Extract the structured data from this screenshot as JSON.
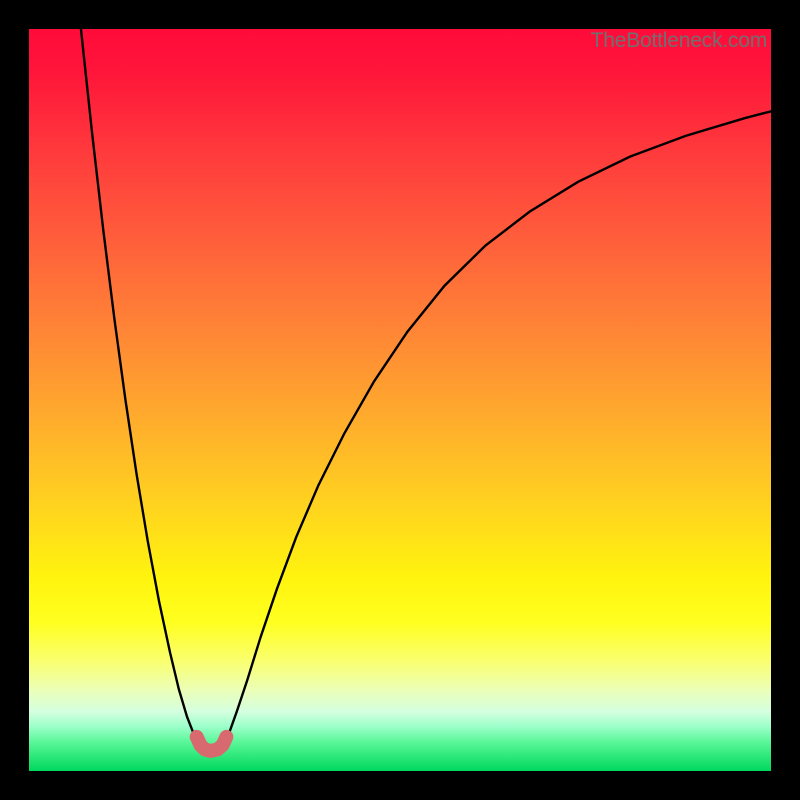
{
  "watermark": "TheBottleneck.com",
  "chart_data": {
    "type": "line",
    "title": "",
    "xlabel": "",
    "ylabel": "",
    "xlim": [
      0,
      100
    ],
    "ylim": [
      0,
      100
    ],
    "legend": false,
    "grid": false,
    "background_gradient": {
      "top": "#ff0b3a",
      "bottom": "#00d85f",
      "stops": [
        "red",
        "orange",
        "yellow",
        "green"
      ]
    },
    "series": [
      {
        "name": "left-branch",
        "stroke": "#000000",
        "x": [
          7.0,
          8.5,
          10.0,
          11.5,
          13.0,
          14.5,
          16.0,
          17.5,
          19.0,
          20.2,
          21.3,
          22.2,
          23.0
        ],
        "y": [
          100.0,
          86.0,
          73.0,
          61.0,
          50.0,
          40.0,
          31.0,
          23.0,
          16.0,
          11.0,
          7.3,
          5.0,
          3.6
        ]
      },
      {
        "name": "right-branch",
        "stroke": "#000000",
        "x": [
          26.2,
          27.0,
          28.0,
          29.4,
          31.2,
          33.4,
          36.0,
          39.0,
          42.5,
          46.5,
          51.0,
          56.0,
          61.5,
          67.5,
          74.0,
          81.0,
          88.5,
          96.5,
          100.0
        ],
        "y": [
          3.6,
          5.2,
          8.0,
          12.2,
          18.0,
          24.5,
          31.5,
          38.5,
          45.5,
          52.5,
          59.2,
          65.4,
          70.8,
          75.4,
          79.4,
          82.8,
          85.6,
          88.0,
          88.9
        ]
      },
      {
        "name": "bottom-marker",
        "stroke": "#d86a6f",
        "marker": "round",
        "x": [
          22.6,
          23.1,
          23.7,
          24.5,
          25.4,
          26.1,
          26.6
        ],
        "y": [
          4.6,
          3.5,
          2.9,
          2.7,
          2.9,
          3.5,
          4.6
        ]
      }
    ]
  }
}
